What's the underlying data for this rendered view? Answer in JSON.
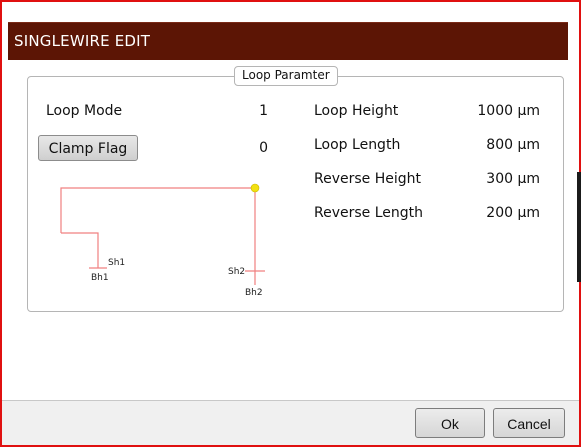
{
  "dialog": {
    "title": "SINGLEWIRE EDIT",
    "group_title": "Loop Paramter",
    "loop_mode_label": "Loop Mode",
    "loop_mode_value": "1",
    "clamp_flag_label": "Clamp Flag",
    "clamp_flag_value": "0",
    "params": [
      {
        "label": "Loop Height",
        "value": "1000 μm"
      },
      {
        "label": "Loop Length",
        "value": "800 μm"
      },
      {
        "label": "Reverse Height",
        "value": "300 μm"
      },
      {
        "label": "Reverse Length",
        "value": "200 μm"
      }
    ],
    "diagram": {
      "sh1": "Sh1",
      "bh1": "Bh1",
      "sh2": "Sh2",
      "bh2": "Bh2",
      "wire_color": "#f08080",
      "node_color": "#f2e010"
    },
    "ok_label": "Ok",
    "cancel_label": "Cancel"
  },
  "colors": {
    "titlebar": "#5c1505",
    "border_accent": "#e01010"
  }
}
